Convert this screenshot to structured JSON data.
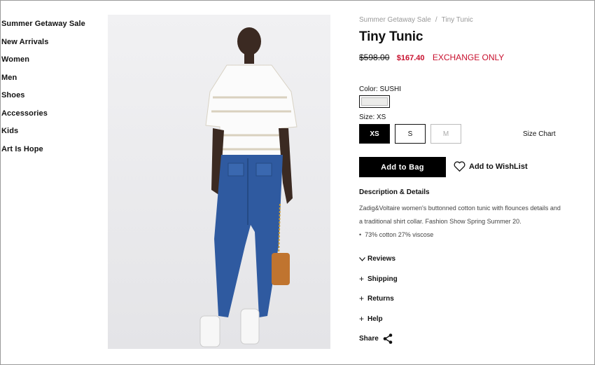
{
  "sidebar": {
    "items": [
      "Summer Getaway Sale",
      "New Arrivals",
      "Women",
      "Men",
      "Shoes",
      "Accessories",
      "Kids",
      "Art Is Hope"
    ]
  },
  "breadcrumb": {
    "parent": "Summer Getaway Sale",
    "separator": "/",
    "current": "Tiny Tunic"
  },
  "product": {
    "title": "Tiny Tunic",
    "price_original": "$598.00",
    "price_sale": "$167.40",
    "availability": "EXCHANGE ONLY",
    "color_label": "Color: SUSHI",
    "size_label": "Size: XS",
    "sizes": [
      "XS",
      "S",
      "M"
    ],
    "size_chart": "Size Chart",
    "add_to_bag": "Add to Bag",
    "add_to_wishlist": "Add to WishList"
  },
  "description": {
    "heading": "Description & Details",
    "text": "Zadig&Voltaire women's buttonned cotton tunic with flounces details and a traditional shirt collar. Fashion Show Spring Summer 20.",
    "bullet": "73% cotton 27% viscose"
  },
  "accordion": {
    "reviews": "Reviews",
    "shipping": "Shipping",
    "returns": "Returns",
    "help": "Help"
  },
  "share_label": "Share",
  "colors": {
    "sale_red": "#c8102e",
    "black": "#000000",
    "swatch": "#ececea"
  }
}
